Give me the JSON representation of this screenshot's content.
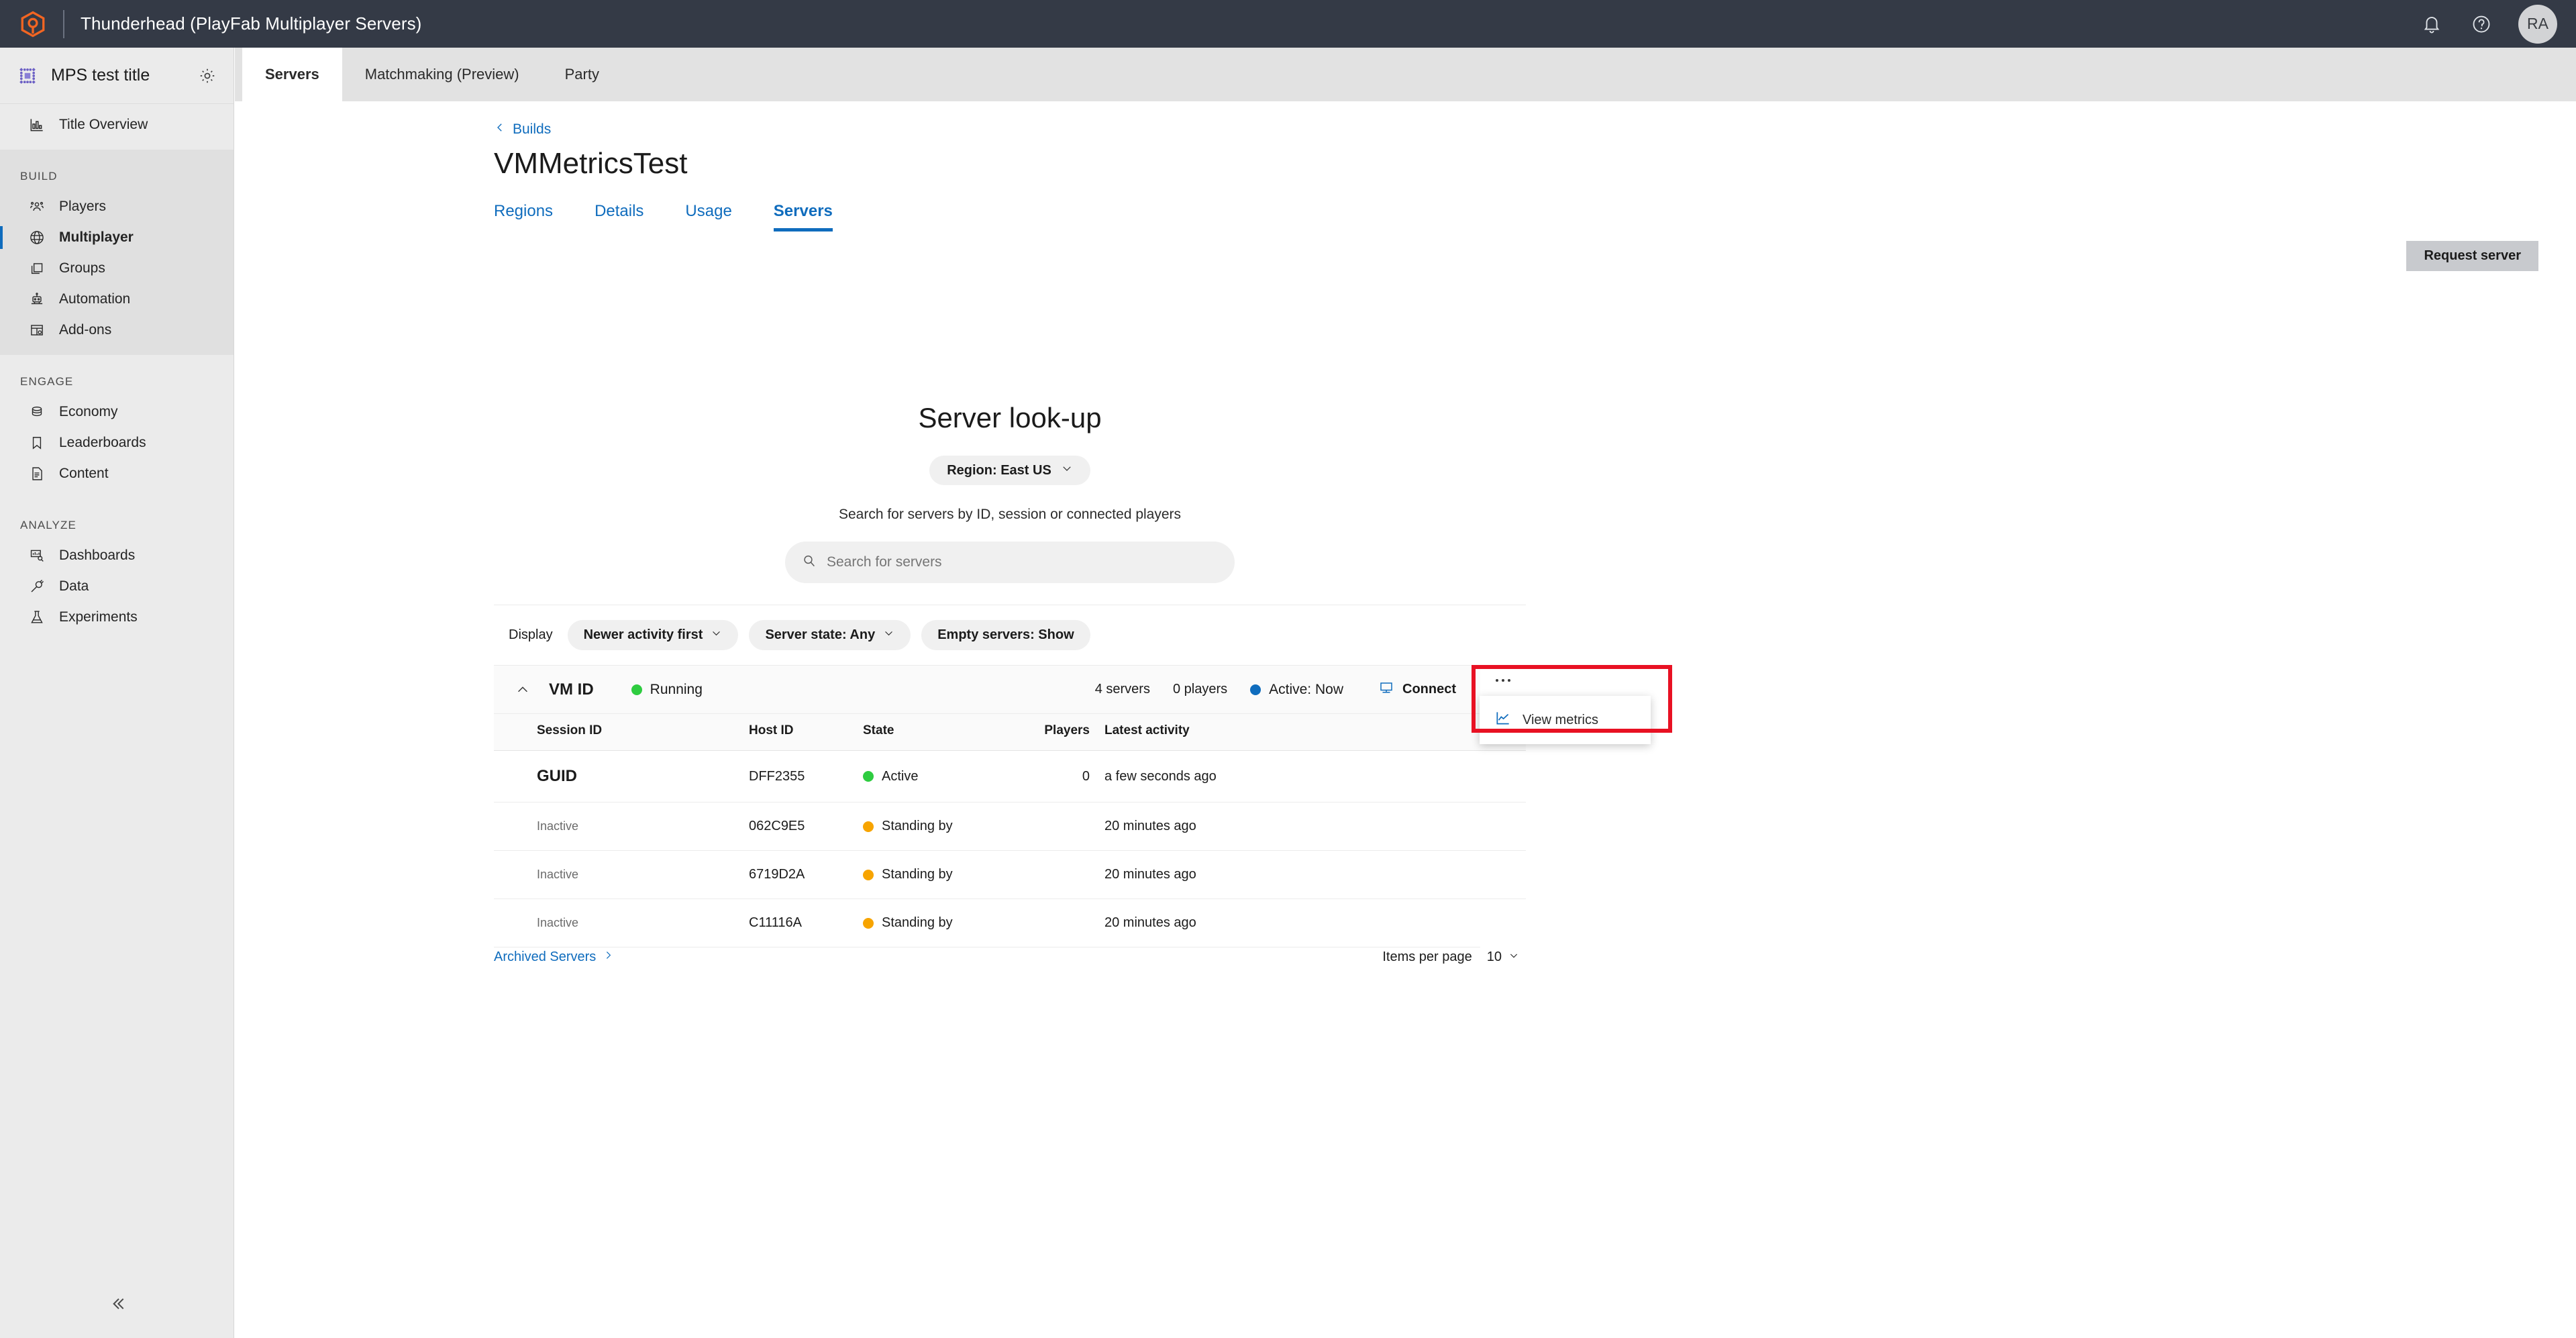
{
  "topbar": {
    "product_title": "Thunderhead (PlayFab Multiplayer Servers)",
    "logo_icon": "playfab-logo-icon",
    "notifications_icon": "bell-icon",
    "help_icon": "help-circle-icon",
    "avatar_initials": "RA"
  },
  "sidebar": {
    "title": "MPS test title",
    "title_icon": "title-grid-icon",
    "settings_icon": "gear-icon",
    "collapse_icon": "double-chevron-left-icon",
    "overview": {
      "label": "Title Overview",
      "icon": "bar-chart-icon"
    },
    "groups": [
      {
        "label": "BUILD",
        "items": [
          {
            "label": "Players",
            "icon": "people-icon",
            "active": false
          },
          {
            "label": "Multiplayer",
            "icon": "globe-icon",
            "active": true
          },
          {
            "label": "Groups",
            "icon": "layers-icon",
            "active": false
          },
          {
            "label": "Automation",
            "icon": "robot-icon",
            "active": false
          },
          {
            "label": "Add-ons",
            "icon": "addons-icon",
            "active": false
          }
        ]
      },
      {
        "label": "ENGAGE",
        "items": [
          {
            "label": "Economy",
            "icon": "coins-icon",
            "active": false
          },
          {
            "label": "Leaderboards",
            "icon": "bookmark-icon",
            "active": false
          },
          {
            "label": "Content",
            "icon": "document-icon",
            "active": false
          }
        ]
      },
      {
        "label": "ANALYZE",
        "items": [
          {
            "label": "Dashboards",
            "icon": "dashboard-search-icon",
            "active": false
          },
          {
            "label": "Data",
            "icon": "plug-icon",
            "active": false
          },
          {
            "label": "Experiments",
            "icon": "flask-icon",
            "active": false
          }
        ]
      }
    ]
  },
  "tabs": [
    {
      "label": "Servers",
      "selected": true
    },
    {
      "label": "Matchmaking (Preview)",
      "selected": false
    },
    {
      "label": "Party",
      "selected": false
    }
  ],
  "header": {
    "breadcrumb": "Builds",
    "breadcrumb_icon": "chevron-left-icon",
    "page_title": "VMMetricsTest",
    "request_server_label": "Request server"
  },
  "subtabs": [
    {
      "label": "Regions",
      "selected": false
    },
    {
      "label": "Details",
      "selected": false
    },
    {
      "label": "Usage",
      "selected": false
    },
    {
      "label": "Servers",
      "selected": true
    }
  ],
  "lookup": {
    "title": "Server look-up",
    "region_label": "Region: East US",
    "region_chevron_icon": "chevron-down-icon",
    "subtitle": "Search for servers by ID, session or connected players",
    "search_icon": "search-icon",
    "search_value": "",
    "search_placeholder": "Search for servers"
  },
  "display": {
    "label": "Display",
    "filters": [
      {
        "label": "Newer activity first",
        "has_chevron": true
      },
      {
        "label": "Server state: Any",
        "has_chevron": true
      },
      {
        "label": "Empty servers: Show",
        "has_chevron": false
      }
    ],
    "chevron_icon": "chevron-down-icon"
  },
  "vm": {
    "collapse_icon": "chevron-up-icon",
    "id_label": "VM ID",
    "status": "Running",
    "status_color": "#2ecc40",
    "servers_count": "4 servers",
    "players_count": "0 players",
    "active_label": "Active: Now",
    "active_color": "#0f6cbd",
    "connect_label": "Connect",
    "connect_icon": "monitor-icon",
    "more_icon": "ellipsis-icon"
  },
  "context_menu": {
    "items": [
      {
        "label": "View metrics",
        "icon": "line-chart-icon"
      }
    ],
    "highlight_color": "#e81123"
  },
  "table": {
    "columns": [
      "Session ID",
      "Host ID",
      "State",
      "Players",
      "Latest activity"
    ],
    "rows": [
      {
        "session": "GUID",
        "session_style": "guid",
        "host": "DFF2355",
        "state": "Active",
        "state_color": "#2ecc40",
        "players": "0",
        "activity": "a few seconds ago"
      },
      {
        "session": "Inactive",
        "session_style": "inactive",
        "host": "062C9E5",
        "state": "Standing by",
        "state_color": "#f7a400",
        "players": "",
        "activity": "20 minutes ago"
      },
      {
        "session": "Inactive",
        "session_style": "inactive",
        "host": "6719D2A",
        "state": "Standing by",
        "state_color": "#f7a400",
        "players": "",
        "activity": "20 minutes ago"
      },
      {
        "session": "Inactive",
        "session_style": "inactive",
        "host": "C11116A",
        "state": "Standing by",
        "state_color": "#f7a400",
        "players": "",
        "activity": "20 minutes ago"
      }
    ]
  },
  "footer": {
    "archived_label": "Archived Servers",
    "archived_icon": "chevron-right-icon",
    "items_per_page_label": "Items per page",
    "items_per_page_value": "10",
    "items_per_page_icon": "chevron-down-icon"
  }
}
